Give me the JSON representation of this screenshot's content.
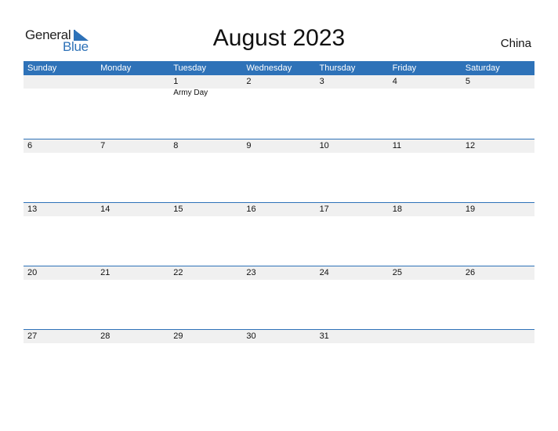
{
  "logo": {
    "line1": "General",
    "line2": "Blue",
    "icon": "triangle-flag-icon",
    "accent": "#2e72b8"
  },
  "title": "August 2023",
  "country": "China",
  "colors": {
    "header_bg": "#2e72b8",
    "date_strip_bg": "#f0f0f0",
    "separator": "#2e72b8"
  },
  "weekdays": [
    "Sunday",
    "Monday",
    "Tuesday",
    "Wednesday",
    "Thursday",
    "Friday",
    "Saturday"
  ],
  "weeks": [
    [
      {
        "day": ""
      },
      {
        "day": ""
      },
      {
        "day": "1",
        "holiday": "Army Day"
      },
      {
        "day": "2"
      },
      {
        "day": "3"
      },
      {
        "day": "4"
      },
      {
        "day": "5"
      }
    ],
    [
      {
        "day": "6"
      },
      {
        "day": "7"
      },
      {
        "day": "8"
      },
      {
        "day": "9"
      },
      {
        "day": "10"
      },
      {
        "day": "11"
      },
      {
        "day": "12"
      }
    ],
    [
      {
        "day": "13"
      },
      {
        "day": "14"
      },
      {
        "day": "15"
      },
      {
        "day": "16"
      },
      {
        "day": "17"
      },
      {
        "day": "18"
      },
      {
        "day": "19"
      }
    ],
    [
      {
        "day": "20"
      },
      {
        "day": "21"
      },
      {
        "day": "22"
      },
      {
        "day": "23"
      },
      {
        "day": "24"
      },
      {
        "day": "25"
      },
      {
        "day": "26"
      }
    ],
    [
      {
        "day": "27"
      },
      {
        "day": "28"
      },
      {
        "day": "29"
      },
      {
        "day": "30"
      },
      {
        "day": "31"
      },
      {
        "day": ""
      },
      {
        "day": ""
      }
    ]
  ]
}
